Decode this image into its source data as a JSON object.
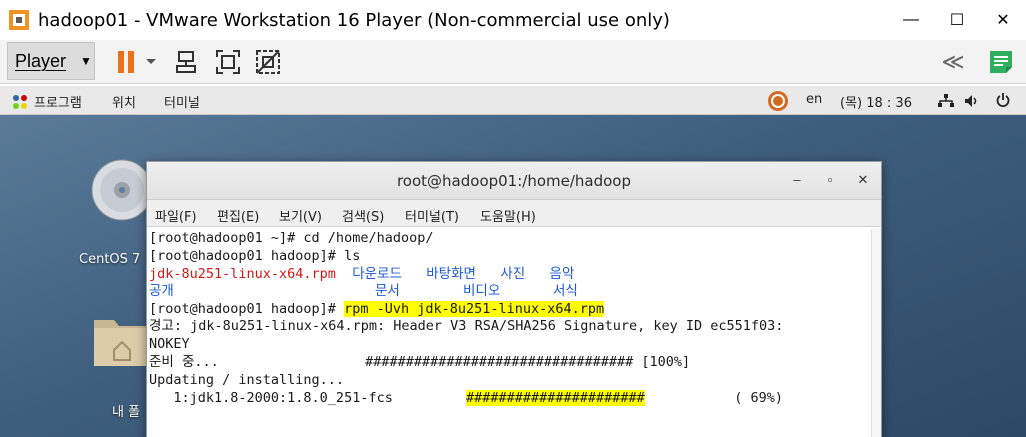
{
  "window": {
    "title": "hadoop01 - VMware Workstation 16 Player (Non-commercial use only)",
    "minimize": "—",
    "maximize": "☐",
    "close": "✕"
  },
  "toolbar": {
    "player_label": "Player",
    "player_caret": "▼",
    "chevron": "≪"
  },
  "gnome": {
    "menus": [
      "프로그램",
      "위치",
      "터미널"
    ],
    "lang": "en",
    "clock": "(목) 18 : 36"
  },
  "desktop": {
    "icons": [
      {
        "label": "CentOS 7"
      },
      {
        "label": "내 폴"
      }
    ]
  },
  "terminal": {
    "title": "root@hadoop01:/home/hadoop",
    "buttons": {
      "minimize": "–",
      "maximize": "▫",
      "close": "✕"
    },
    "menu": [
      "파일(F)",
      "편집(E)",
      "보기(V)",
      "검색(S)",
      "터미널(T)",
      "도움말(H)"
    ],
    "lines": {
      "l1": "[root@hadoop01 ~]# cd /home/hadoop/",
      "l2": "[root@hadoop01 hadoop]# ls",
      "l3_file": "jdk-8u251-linux-x64.rpm",
      "l3_dirs": "  다운로드   바탕화면   사진   음악",
      "l4_a": "공개",
      "l4_b": "문서",
      "l4_c": "비디오",
      "l4_d": "서식",
      "l5_prompt": "[root@hadoop01 hadoop]# ",
      "l5_cmd": "rpm -Uvh jdk-8u251-linux-x64.rpm",
      "l6": "경고: jdk-8u251-linux-x64.rpm: Header V3 RSA/SHA256 Signature, key ID ec551f03:",
      "l7": "NOKEY",
      "l8": "준비 중...                  ################################# [100%]",
      "l9": "Updating / installing...",
      "l10_pkg": "   1:jdk1.8-2000:1.8.0_251-fcs         ",
      "l10_bar": "######################",
      "l10_pct": "           ( 69%)"
    }
  },
  "colors": {
    "highlight": "#ffff00",
    "file_red": "#d01818",
    "dir_blue": "#1c59d6",
    "pause_orange": "#e8731c",
    "notes_green": "#2eaf5f"
  }
}
